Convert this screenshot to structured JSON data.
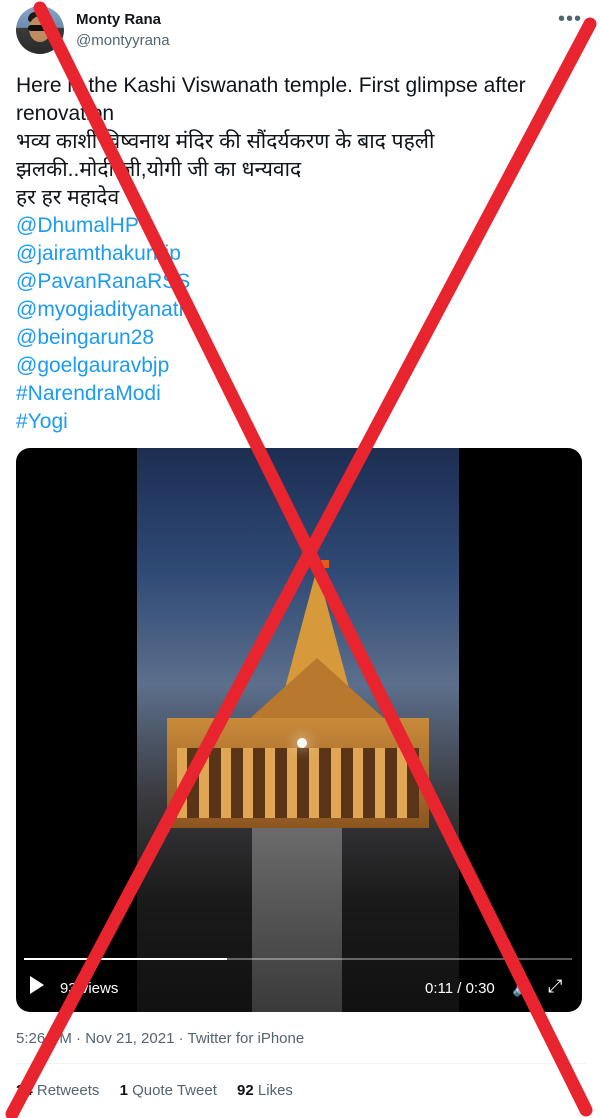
{
  "author": {
    "name": "Monty Rana",
    "handle": "@montyyrana"
  },
  "tweet": {
    "lines": [
      "Here is the Kashi Viswanath temple. First glimpse after",
      "renovation",
      "भव्य काशी विष्वनाथ मंदिर की सौंदर्यकरण के बाद पहली",
      "झलकी..मोदी जी,योगी जी का धन्यवाद",
      "हर हर महादेव"
    ],
    "links": [
      "@DhumalHP",
      "@jairamthakurbjp",
      "@PavanRanaRSS",
      "@myogiadityanath",
      "@beingarun28",
      "@goelgauravbjp",
      "#NarendraModi",
      "#Yogi"
    ]
  },
  "video": {
    "views": "93 views",
    "time": "0:11 / 0:30",
    "progress": 0.37
  },
  "meta": "5:26 PM · Nov 21, 2021 · Twitter for iPhone",
  "stats": {
    "retweets_count": "24",
    "retweets_label": "Retweets",
    "quotes_count": "1",
    "quotes_label": "Quote Tweet",
    "likes_count": "92",
    "likes_label": "Likes"
  },
  "colors": {
    "link": "#1d9bf0",
    "cross": "#e8242f"
  },
  "icons": {
    "more": "more-icon",
    "play": "play-icon",
    "volume": "volume-icon",
    "fullscreen": "fullscreen-icon"
  }
}
